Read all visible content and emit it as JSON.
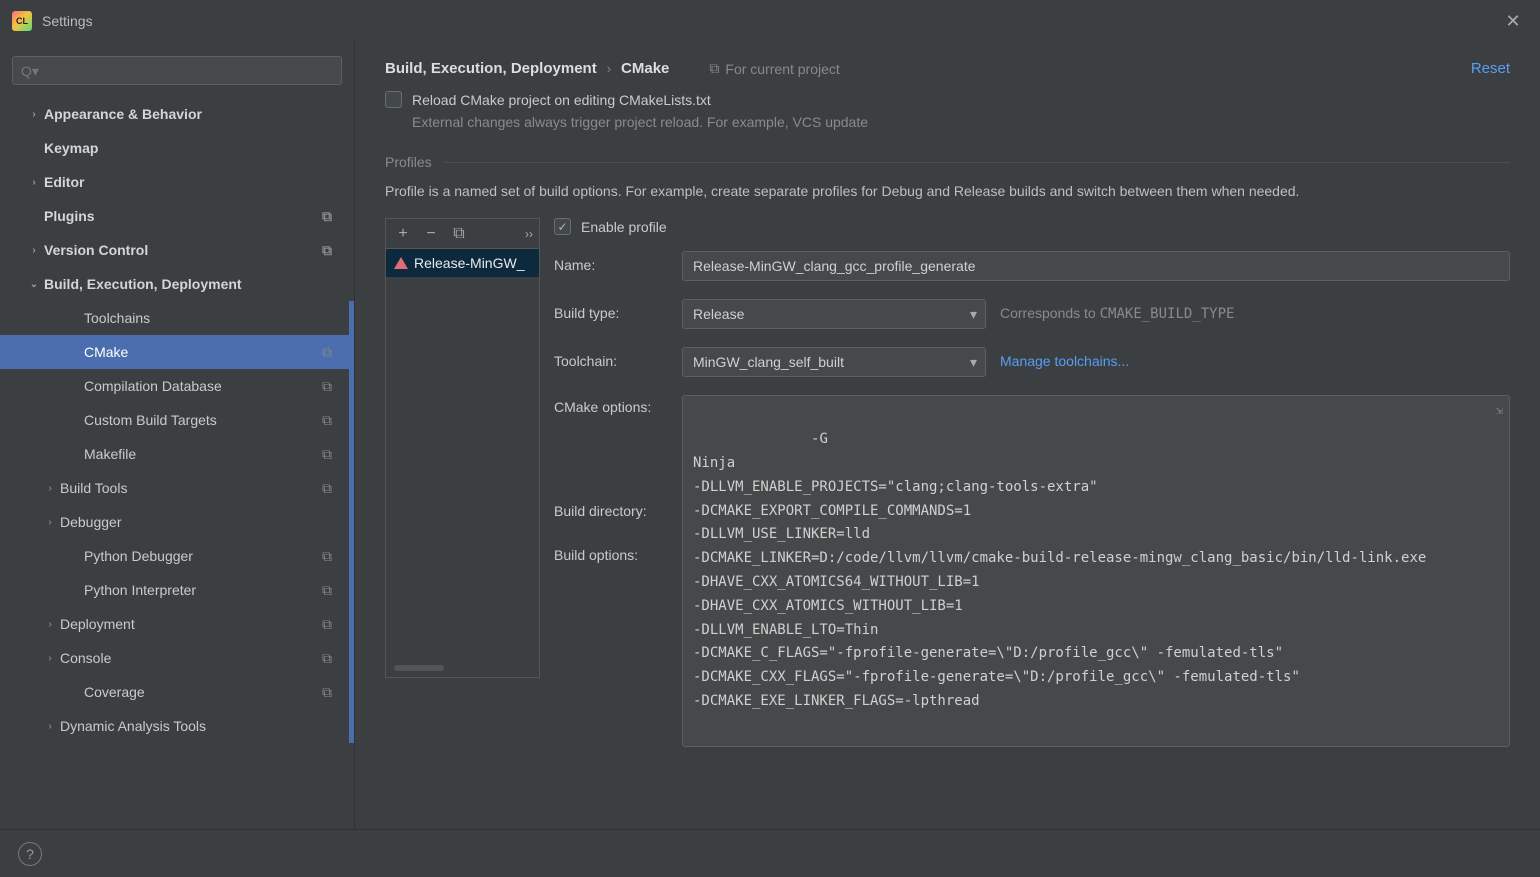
{
  "window": {
    "title": "Settings",
    "reset_label": "Reset"
  },
  "search": {
    "placeholder": "Q▾"
  },
  "sidebar": {
    "items": [
      {
        "label": "Appearance & Behavior",
        "chev": "›",
        "bold": true,
        "indent": 0
      },
      {
        "label": "Keymap",
        "chev": "",
        "bold": true,
        "indent": 0
      },
      {
        "label": "Editor",
        "chev": "›",
        "bold": true,
        "indent": 0
      },
      {
        "label": "Plugins",
        "chev": "",
        "bold": true,
        "indent": 0,
        "proj": true
      },
      {
        "label": "Version Control",
        "chev": "›",
        "bold": true,
        "indent": 0,
        "proj": true
      },
      {
        "label": "Build, Execution, Deployment",
        "chev": "⌄",
        "bold": true,
        "indent": 0
      },
      {
        "label": "Toolchains",
        "chev": "",
        "bold": false,
        "indent": 2
      },
      {
        "label": "CMake",
        "chev": "",
        "bold": false,
        "indent": 2,
        "selected": true,
        "proj": true
      },
      {
        "label": "Compilation Database",
        "chev": "",
        "bold": false,
        "indent": 2,
        "proj": true
      },
      {
        "label": "Custom Build Targets",
        "chev": "",
        "bold": false,
        "indent": 2,
        "proj": true
      },
      {
        "label": "Makefile",
        "chev": "",
        "bold": false,
        "indent": 2,
        "proj": true
      },
      {
        "label": "Build Tools",
        "chev": "›",
        "bold": false,
        "indent": 1,
        "proj": true
      },
      {
        "label": "Debugger",
        "chev": "›",
        "bold": false,
        "indent": 1
      },
      {
        "label": "Python Debugger",
        "chev": "",
        "bold": false,
        "indent": 2,
        "proj": true
      },
      {
        "label": "Python Interpreter",
        "chev": "",
        "bold": false,
        "indent": 2,
        "proj": true
      },
      {
        "label": "Deployment",
        "chev": "›",
        "bold": false,
        "indent": 1,
        "proj": true
      },
      {
        "label": "Console",
        "chev": "›",
        "bold": false,
        "indent": 1,
        "proj": true
      },
      {
        "label": "Coverage",
        "chev": "",
        "bold": false,
        "indent": 2,
        "proj": true
      },
      {
        "label": "Dynamic Analysis Tools",
        "chev": "›",
        "bold": false,
        "indent": 1
      }
    ]
  },
  "breadcrumb": {
    "root": "Build, Execution, Deployment",
    "leaf": "CMake",
    "for_project": "For current project"
  },
  "reload": {
    "label": "Reload CMake project on editing CMakeLists.txt",
    "hint": "External changes always trigger project reload. For example, VCS update"
  },
  "profiles": {
    "header": "Profiles",
    "description": "Profile is a named set of build options. For example, create separate profiles for Debug and Release builds and switch between them when needed.",
    "list": [
      "Release-MinGW_"
    ],
    "enable_label": "Enable profile",
    "name_label": "Name:",
    "name_value": "Release-MinGW_clang_gcc_profile_generate",
    "build_type_label": "Build type:",
    "build_type_value": "Release",
    "build_type_hint_pre": "Corresponds to ",
    "build_type_hint_code": "CMAKE_BUILD_TYPE",
    "toolchain_label": "Toolchain:",
    "toolchain_value": "MinGW_clang_self_built",
    "toolchain_link": "Manage toolchains...",
    "cmake_options_label": "CMake options:",
    "build_directory_label": "Build directory:",
    "build_options_label": "Build options:",
    "cmake_options_value": "-G\nNinja\n-DLLVM_ENABLE_PROJECTS=\"clang;clang-tools-extra\"\n-DCMAKE_EXPORT_COMPILE_COMMANDS=1\n-DLLVM_USE_LINKER=lld\n-DCMAKE_LINKER=D:/code/llvm/llvm/cmake-build-release-mingw_clang_basic/bin/lld-link.exe\n-DHAVE_CXX_ATOMICS64_WITHOUT_LIB=1\n-DHAVE_CXX_ATOMICS_WITHOUT_LIB=1\n-DLLVM_ENABLE_LTO=Thin\n-DCMAKE_C_FLAGS=\"-fprofile-generate=\\\"D:/profile_gcc\\\" -femulated-tls\"\n-DCMAKE_CXX_FLAGS=\"-fprofile-generate=\\\"D:/profile_gcc\\\" -femulated-tls\"\n-DCMAKE_EXE_LINKER_FLAGS=-lpthread"
  }
}
